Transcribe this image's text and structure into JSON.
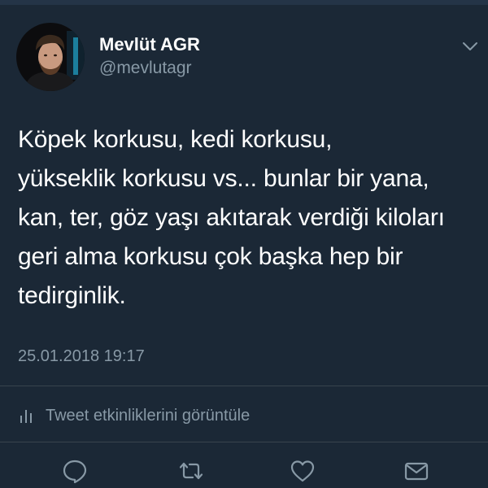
{
  "tweet": {
    "author_name": "Mevlüt AGR",
    "author_handle": "@mevlutagr",
    "text_lines": [
      "Köpek korkusu, kedi korkusu,",
      "yükseklik korkusu vs... bunlar bir yana,",
      "kan, ter, göz yaşı akıtarak verdiği kiloları",
      "geri alma korkusu çok başka hep bir",
      "tedirginlik."
    ],
    "timestamp": "25.01.2018 19:17",
    "activity_label": "Tweet etkinliklerini görüntüle"
  },
  "icons": {
    "menu": "chevron-down-icon",
    "activity": "bar-chart-icon",
    "reply": "reply-icon",
    "retweet": "retweet-icon",
    "like": "heart-icon",
    "message": "envelope-icon"
  },
  "colors": {
    "background": "#1b2836",
    "text_primary": "#ffffff",
    "text_secondary": "#8899a6",
    "divider": "#38444d"
  }
}
